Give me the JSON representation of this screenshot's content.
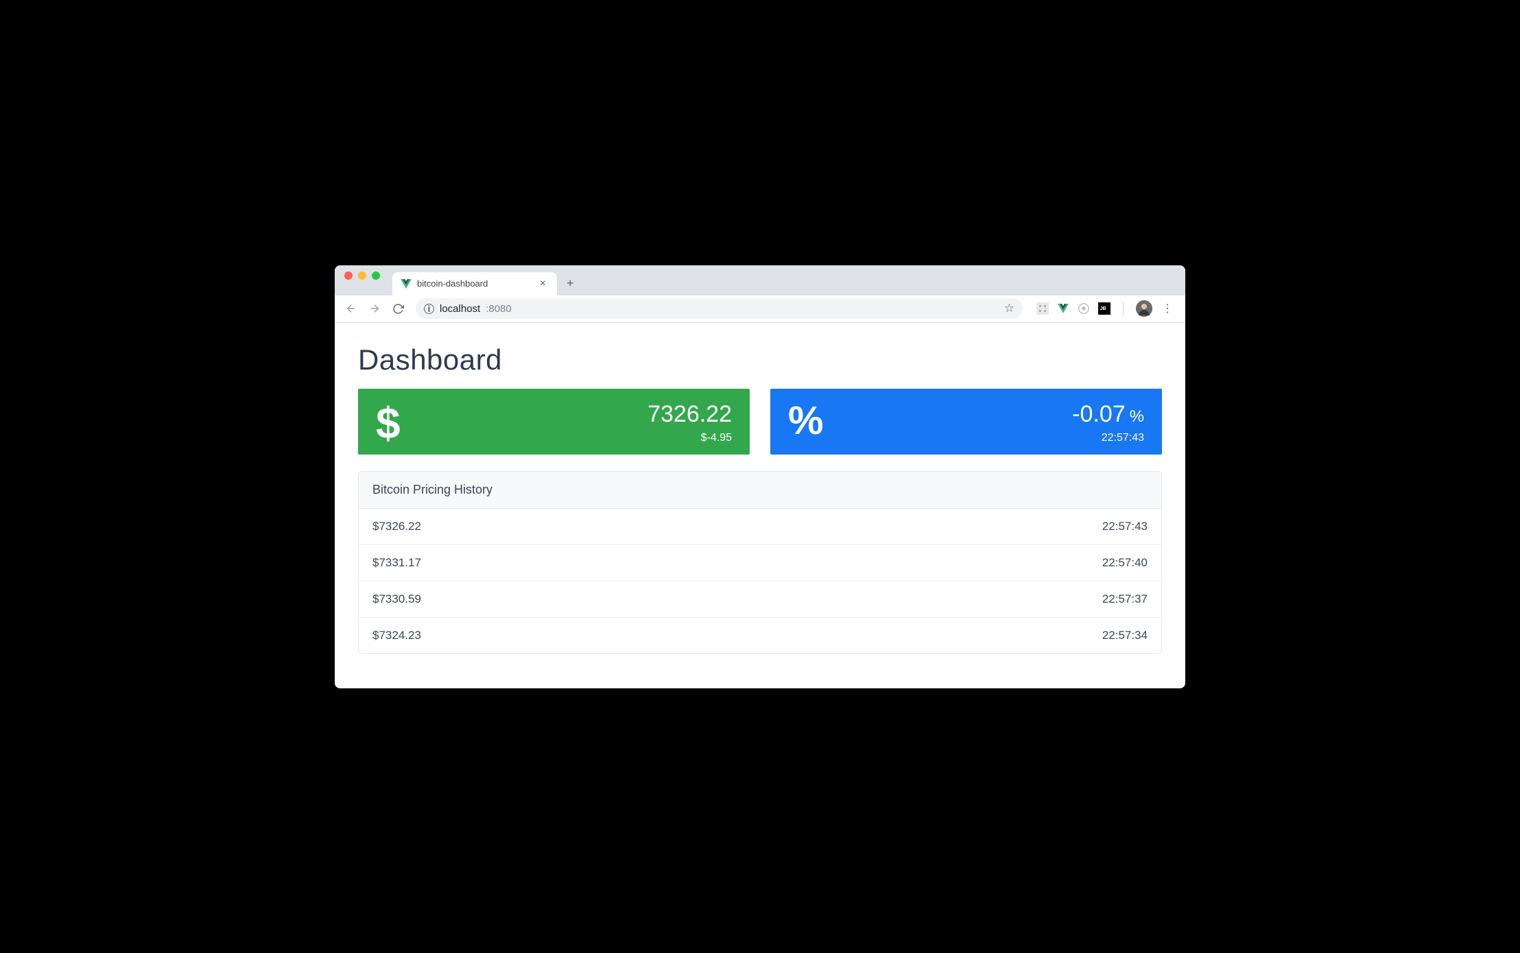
{
  "browser": {
    "tab_title": "bitcoin-dashboard",
    "url_host": "localhost",
    "url_port": ":8080"
  },
  "page": {
    "title": "Dashboard"
  },
  "price_card": {
    "icon": "$",
    "value": "7326.22",
    "delta": "$-4.95"
  },
  "percent_card": {
    "icon": "%",
    "value": "-0.07",
    "unit": "%",
    "time": "22:57:43"
  },
  "history": {
    "title": "Bitcoin Pricing History",
    "rows": [
      {
        "price": "$7326.22",
        "time": "22:57:43"
      },
      {
        "price": "$7331.17",
        "time": "22:57:40"
      },
      {
        "price": "$7330.59",
        "time": "22:57:37"
      },
      {
        "price": "$7324.23",
        "time": "22:57:34"
      }
    ]
  }
}
